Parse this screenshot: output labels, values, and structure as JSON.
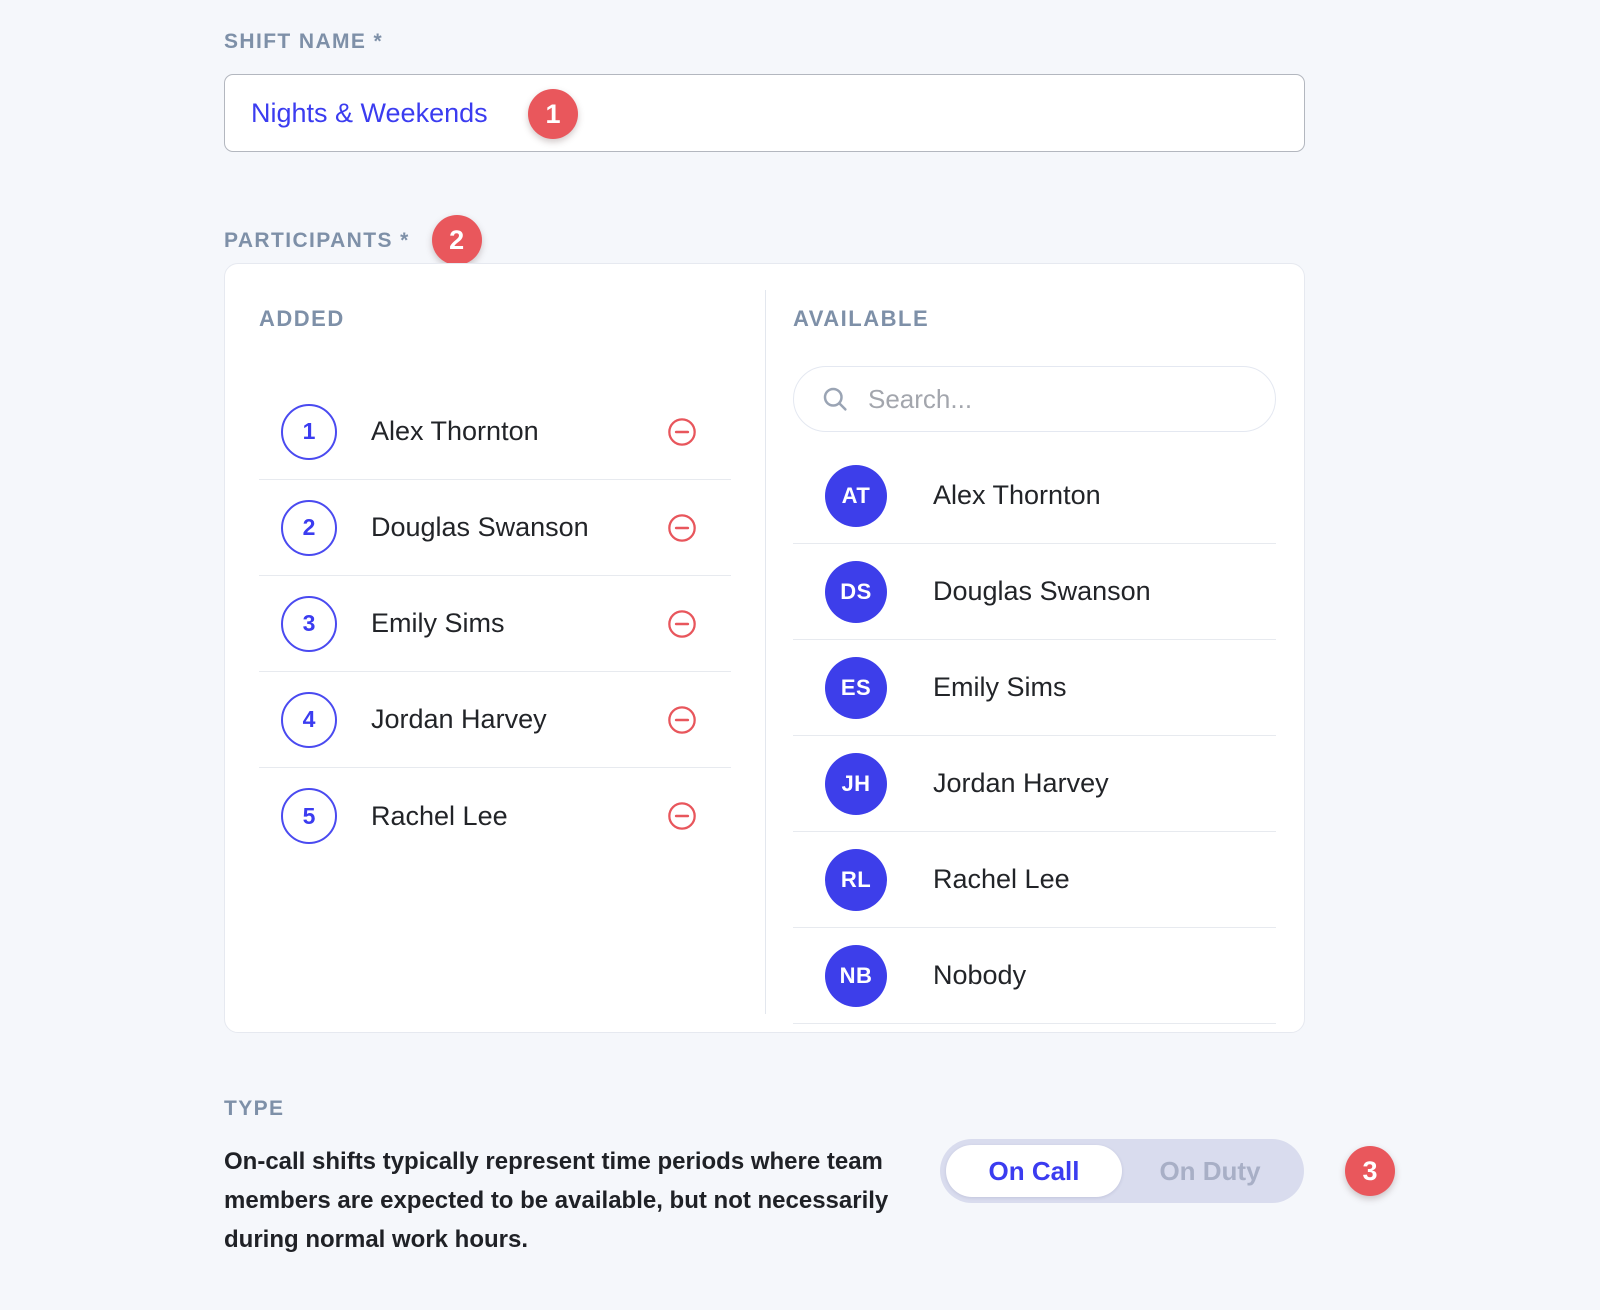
{
  "colors": {
    "page_bg": "#f5f7fb",
    "accent_blue": "#3b3cf0",
    "avatar_blue": "#3d3eea",
    "badge_red": "#e9575c",
    "remove_red": "#e8565c",
    "label_slate": "#7e90a8",
    "toggle_track": "#d9dcee"
  },
  "shift_name": {
    "label": "SHIFT NAME *",
    "value": "Nights & Weekends",
    "placeholder": "Shift name",
    "badge": "1"
  },
  "participants": {
    "label": "PARTICIPANTS *",
    "badge": "2",
    "added": {
      "title": "ADDED",
      "items": [
        {
          "index": "1",
          "name": "Alex Thornton",
          "remove_icon": "circle-minus-icon"
        },
        {
          "index": "2",
          "name": "Douglas Swanson",
          "remove_icon": "circle-minus-icon"
        },
        {
          "index": "3",
          "name": "Emily Sims",
          "remove_icon": "circle-minus-icon"
        },
        {
          "index": "4",
          "name": "Jordan Harvey",
          "remove_icon": "circle-minus-icon"
        },
        {
          "index": "5",
          "name": "Rachel Lee",
          "remove_icon": "circle-minus-icon"
        }
      ]
    },
    "available": {
      "title": "AVAILABLE",
      "search": {
        "placeholder": "Search...",
        "value": "",
        "icon": "search-icon"
      },
      "items": [
        {
          "initials": "AT",
          "name": "Alex Thornton"
        },
        {
          "initials": "DS",
          "name": "Douglas Swanson"
        },
        {
          "initials": "ES",
          "name": "Emily Sims"
        },
        {
          "initials": "JH",
          "name": "Jordan Harvey"
        },
        {
          "initials": "RL",
          "name": "Rachel Lee"
        },
        {
          "initials": "NB",
          "name": "Nobody"
        }
      ]
    }
  },
  "type": {
    "label": "TYPE",
    "description": "On-call shifts typically represent time periods where team members are expected to be available, but not necessarily during normal work hours.",
    "badge": "3",
    "toggle": {
      "options": [
        {
          "label": "On Call",
          "active": true
        },
        {
          "label": "On Duty",
          "active": false
        }
      ]
    }
  }
}
